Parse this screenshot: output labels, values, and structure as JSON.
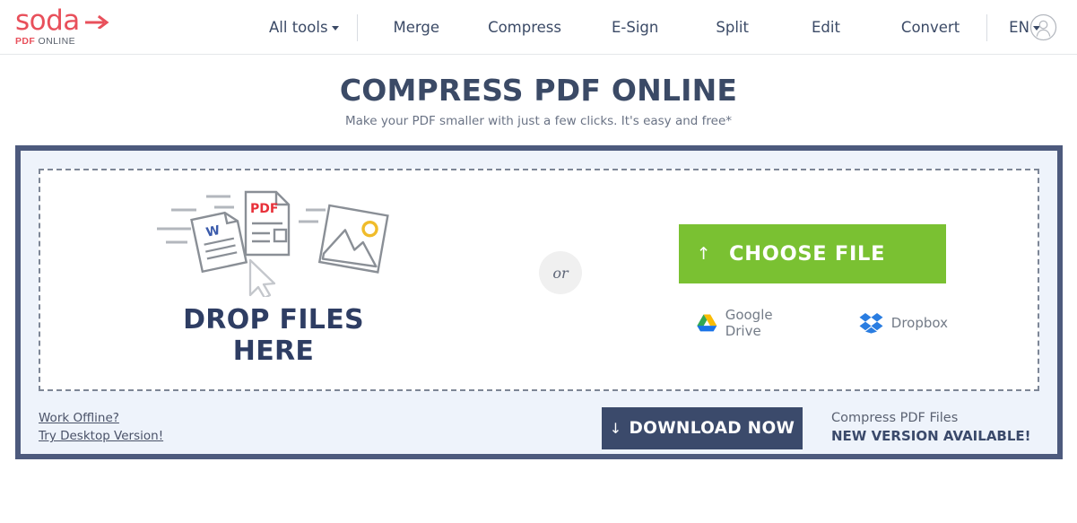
{
  "header": {
    "logo": {
      "word": "soda",
      "arrow_icon": "arrow-right-icon",
      "sub_bold": "PDF",
      "sub_light": " ONLINE"
    },
    "nav": [
      {
        "label": "All tools",
        "has_caret": true
      },
      {
        "label": "Merge",
        "has_caret": false
      },
      {
        "label": "Compress",
        "has_caret": false
      },
      {
        "label": "E-Sign",
        "has_caret": false
      },
      {
        "label": "Split",
        "has_caret": false
      },
      {
        "label": "Edit",
        "has_caret": false
      },
      {
        "label": "Convert",
        "has_caret": false
      }
    ],
    "language": "EN",
    "account_icon": "user-avatar-icon"
  },
  "hero": {
    "title": "COMPRESS PDF ONLINE",
    "subtitle": "Make your PDF smaller with just a few clicks. It's easy and free*"
  },
  "dropzone": {
    "drop_text": "DROP FILES HERE",
    "illustration_icons": [
      "word-doc-icon",
      "pdf-doc-icon",
      "image-file-icon",
      "mouse-cursor-icon"
    ],
    "pdf_label": "PDF",
    "word_label": "W",
    "or_label": "or",
    "choose_file": {
      "label": "CHOOSE FILE",
      "icon": "upload-arrow-icon"
    },
    "cloud_sources": [
      {
        "label": "Google Drive",
        "icon": "google-drive-icon"
      },
      {
        "label": "Dropbox",
        "icon": "dropbox-icon"
      }
    ]
  },
  "bottom": {
    "links": [
      {
        "label": "Work Offline?"
      },
      {
        "label": "Try Desktop Version!"
      }
    ],
    "download_button": {
      "label": "DOWNLOAD NOW",
      "icon": "download-arrow-icon"
    },
    "promo_line1": "Compress PDF Files",
    "promo_line2": "NEW VERSION AVAILABLE!"
  },
  "colors": {
    "brand_red": "#e8505b",
    "navy": "#3b4a6b",
    "green_cta": "#7ac132",
    "panel_border": "#4d5a7d",
    "panel_bg": "#eef3fb"
  }
}
